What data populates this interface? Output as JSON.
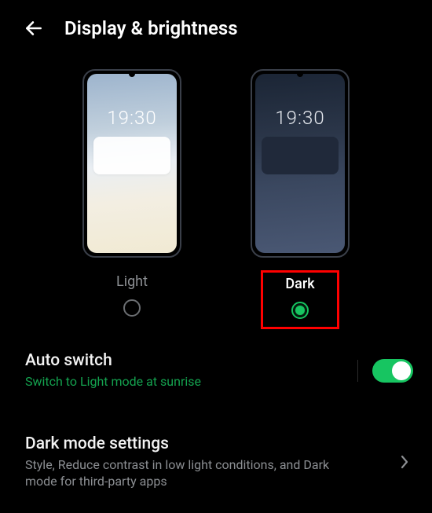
{
  "header": {
    "title": "Display & brightness"
  },
  "themes": {
    "preview_time": "19:30",
    "light_label": "Light",
    "dark_label": "Dark",
    "selected": "dark"
  },
  "auto_switch": {
    "title": "Auto switch",
    "subtitle": "Switch to Light mode at sunrise",
    "enabled": true
  },
  "dark_mode_settings": {
    "title": "Dark mode settings",
    "subtitle": "Style, Reduce contrast in low light conditions, and Dark mode for third-party apps"
  },
  "colors": {
    "accent": "#17c561",
    "highlight": "#ff0000"
  }
}
